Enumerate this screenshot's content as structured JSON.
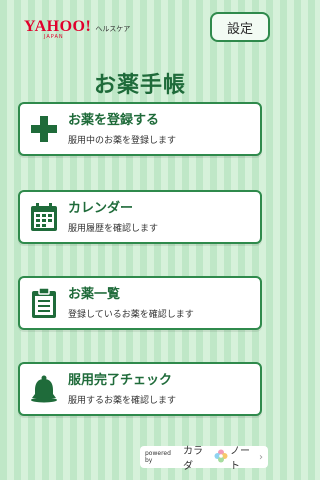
{
  "header": {
    "logo_main": "YAHOO!",
    "logo_sub": "ヘルスケア",
    "logo_japan": "JAPAN",
    "settings_label": "設定"
  },
  "page": {
    "title": "お薬手帳"
  },
  "menu": [
    {
      "title": "お薬を登録する",
      "desc": "服用中のお薬を登録します",
      "icon": "plus-icon"
    },
    {
      "title": "カレンダー",
      "desc": "服用履歴を確認します",
      "icon": "calendar-icon"
    },
    {
      "title": "お薬一覧",
      "desc": "登録しているお薬を確認します",
      "icon": "clipboard-icon"
    },
    {
      "title": "服用完了チェック",
      "desc": "服用するお薬を確認します",
      "icon": "bell-icon"
    }
  ],
  "footer": {
    "powered_by": "powered by",
    "brand_left": "カラダ",
    "brand_right": "ノート",
    "chevron": "›"
  },
  "colors": {
    "accent": "#2f8a4c",
    "title_green": "#1f6b3a",
    "brand_red": "#e1002c"
  }
}
